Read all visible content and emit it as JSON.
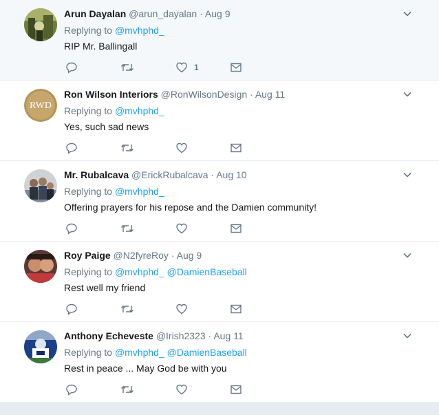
{
  "colors": {
    "link": "#1da1f2",
    "muted": "#657786",
    "text": "#14171a",
    "separator": "#e6ecf0"
  },
  "icons": {
    "reply": "reply-icon",
    "retweet": "retweet-icon",
    "like": "heart-icon",
    "dm": "envelope-icon",
    "more": "chevron-down-icon"
  },
  "tweets": [
    {
      "name": "Arun Dayalan",
      "handle": "@arun_dayalan",
      "dot": "·",
      "time": "Aug 9",
      "replying_prefix": "Replying to",
      "mentions": [
        "@mvhphd_"
      ],
      "text": "RIP Mr. Ballingall",
      "like_count": "1"
    },
    {
      "name": "Ron Wilson Interiors",
      "handle": "@RonWilsonDesign",
      "dot": "·",
      "time": "Aug 11",
      "replying_prefix": "Replying to",
      "mentions": [
        "@mvhphd_"
      ],
      "text": "Yes, such sad news",
      "avatar_text": "RWD",
      "like_count": ""
    },
    {
      "name": "Mr. Rubalcava",
      "handle": "@ErickRubalcava",
      "dot": "·",
      "time": "Aug 10",
      "replying_prefix": "Replying to",
      "mentions": [
        "@mvhphd_"
      ],
      "text": "Offering prayers for his repose and the Damien community!",
      "like_count": ""
    },
    {
      "name": "Roy Paige",
      "handle": "@N2fyreRoy",
      "dot": "·",
      "time": "Aug 9",
      "replying_prefix": "Replying to",
      "mentions": [
        "@mvhphd_",
        "@DamienBaseball"
      ],
      "text": "Rest well my friend",
      "like_count": ""
    },
    {
      "name": "Anthony Echeveste",
      "handle": "@Irish2323",
      "dot": "·",
      "time": "Aug 11",
      "replying_prefix": "Replying to",
      "mentions": [
        "@mvhphd_",
        "@DamienBaseball"
      ],
      "text": "Rest in peace ... May God be with you",
      "like_count": ""
    }
  ]
}
